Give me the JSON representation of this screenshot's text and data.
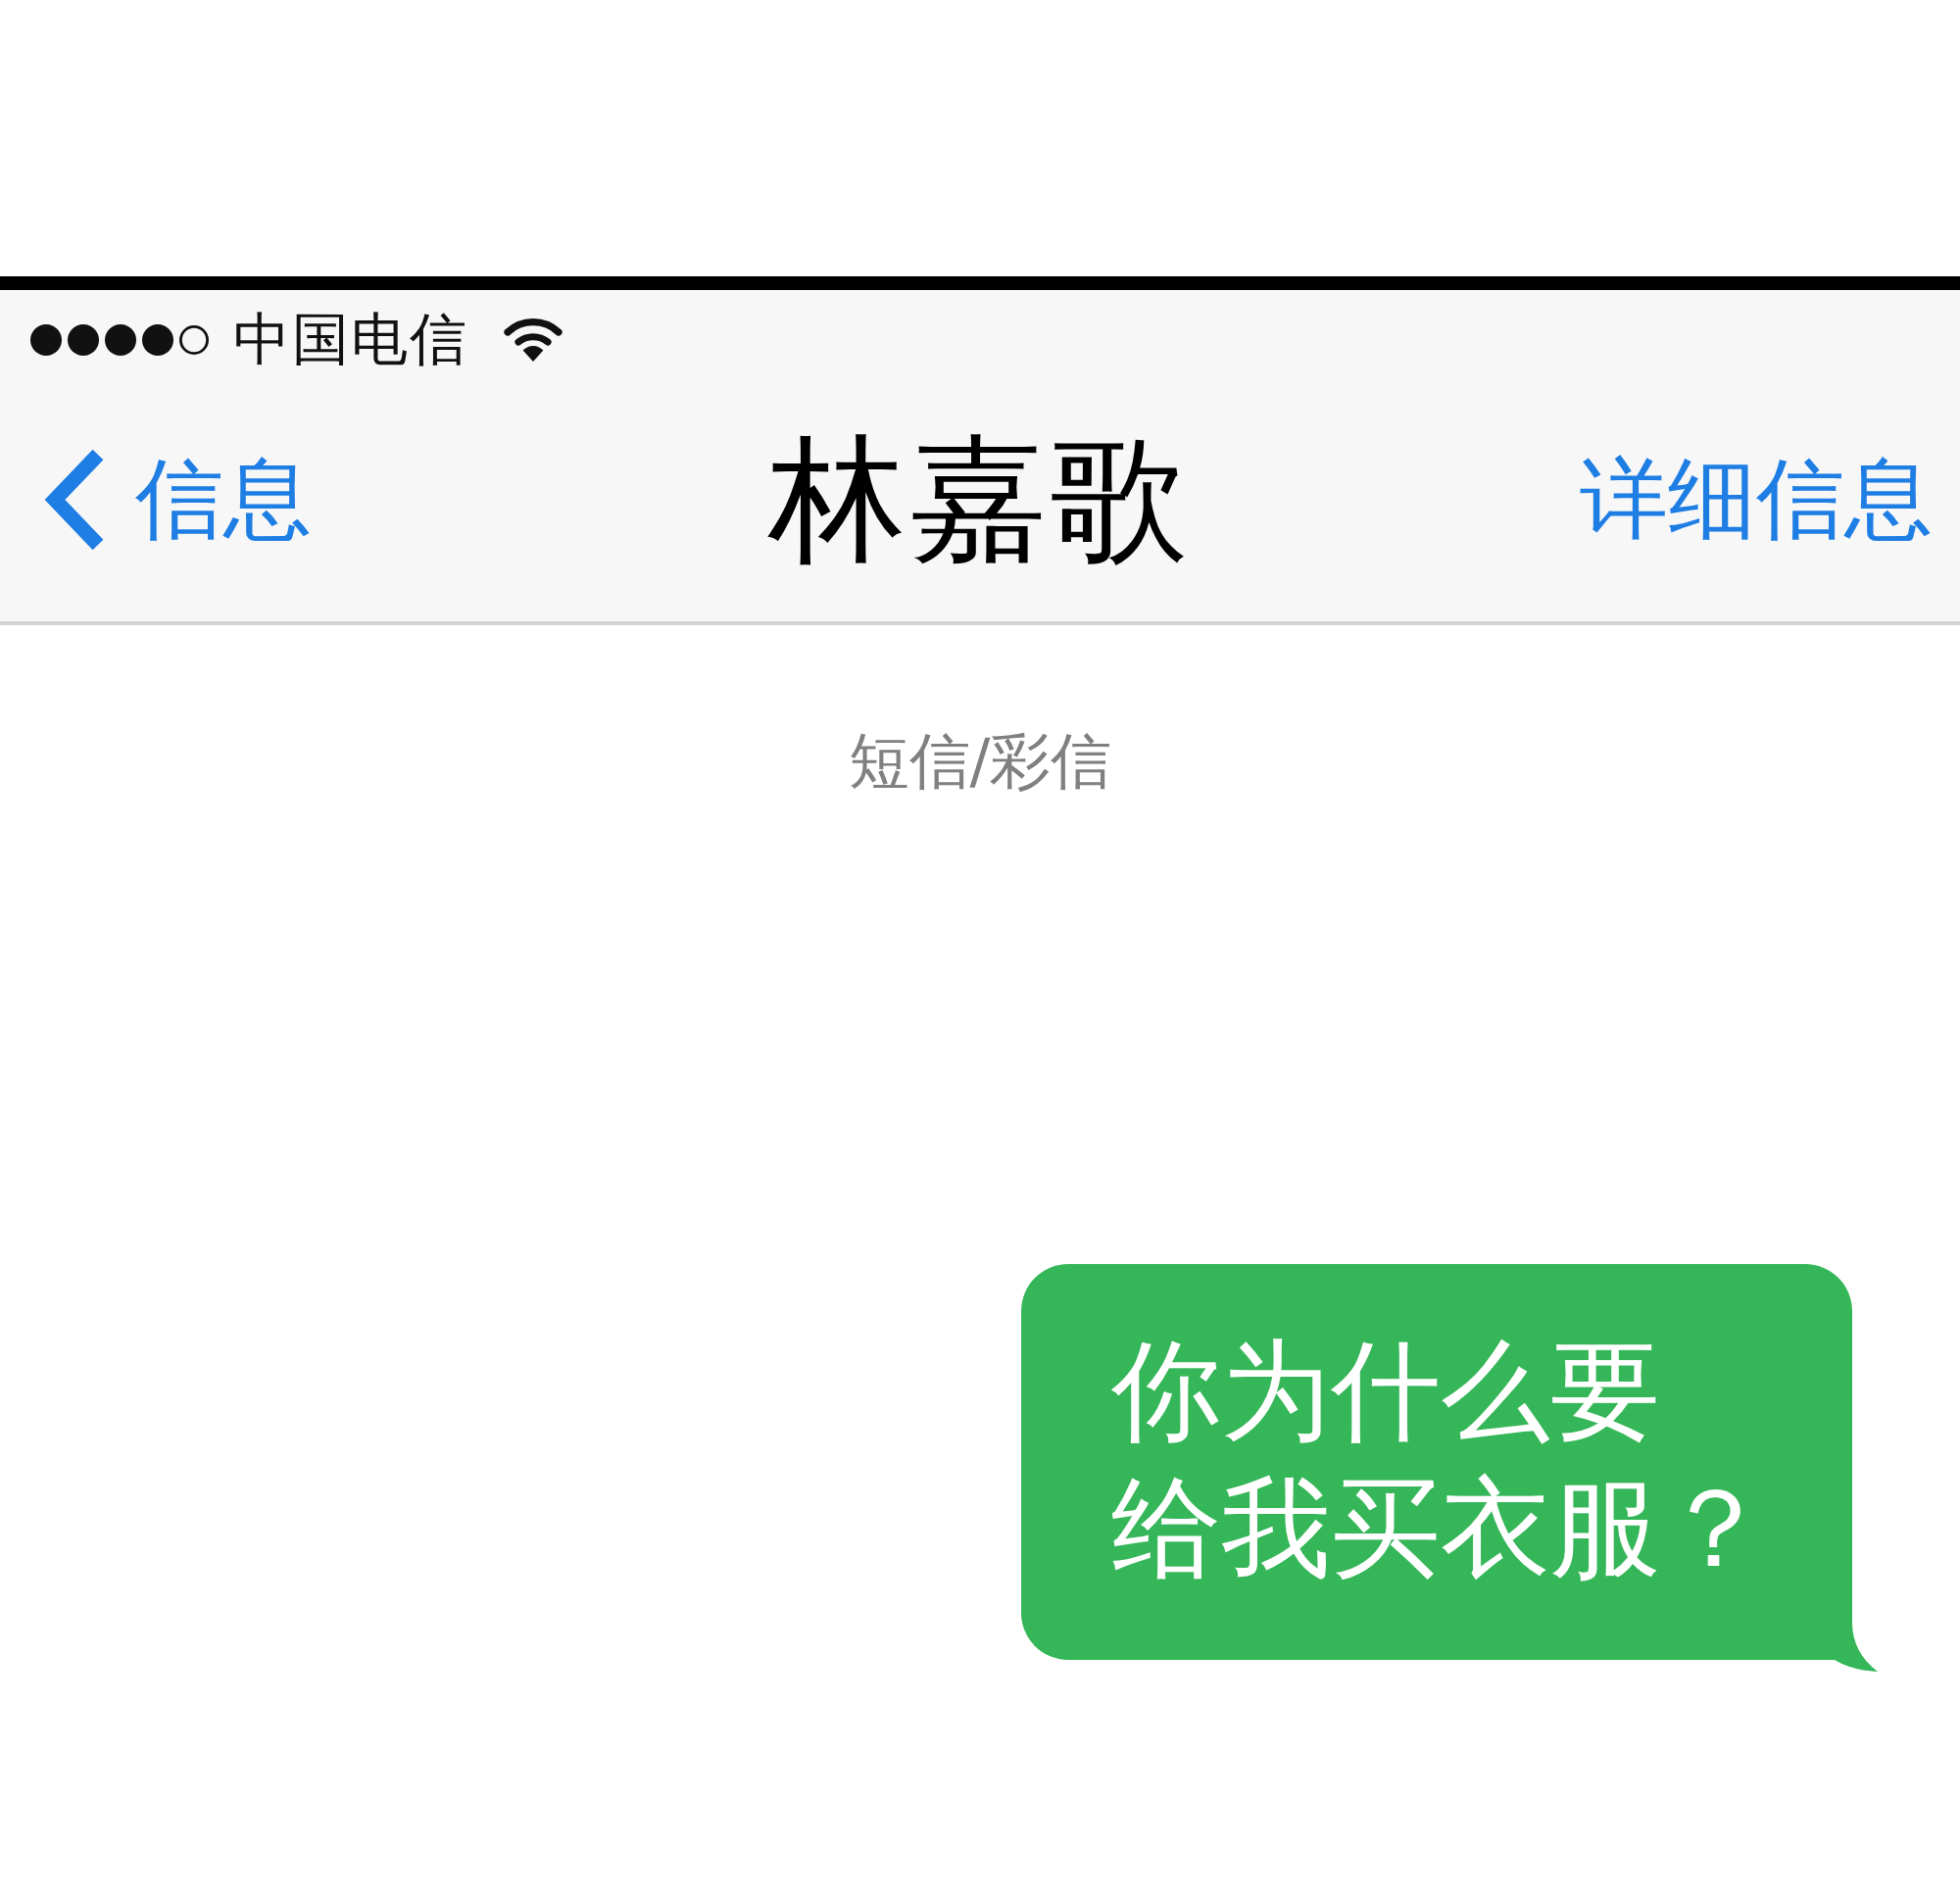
{
  "status_bar": {
    "carrier": "中国电信"
  },
  "nav_bar": {
    "back_label": "信息",
    "title": "林嘉歌",
    "action": "详细信息"
  },
  "conversation": {
    "service_label": "短信/彩信",
    "messages": [
      {
        "kind": "sent",
        "text": "你为什么要给我买衣服？"
      }
    ]
  }
}
